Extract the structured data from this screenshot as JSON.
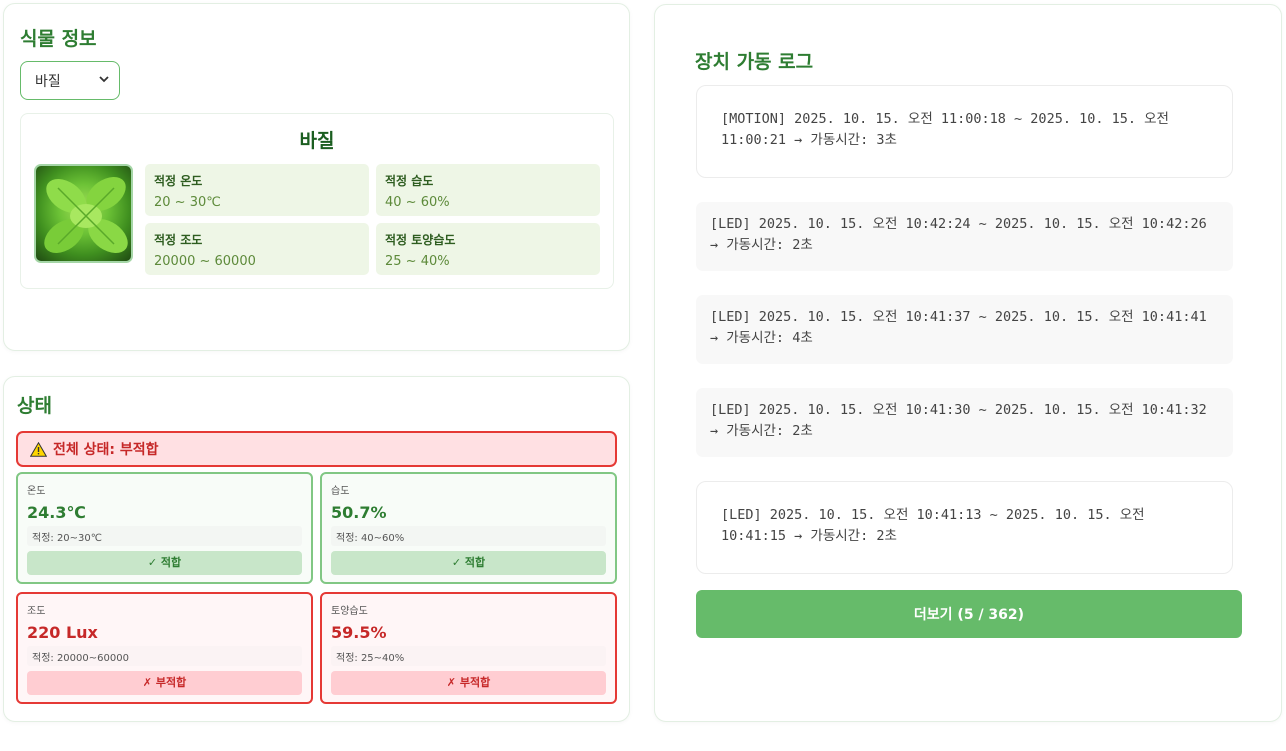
{
  "plant_info": {
    "title": "식물 정보",
    "selected_plant": "바질",
    "plant_name": "바질",
    "image_alt": "basil-plant",
    "ranges": [
      {
        "label": "적정 온도",
        "value": "20 ~ 30℃"
      },
      {
        "label": "적정 습도",
        "value": "40 ~ 60%"
      },
      {
        "label": "적정 조도",
        "value": "20000 ~ 60000"
      },
      {
        "label": "적정 토양습도",
        "value": "25 ~ 40%"
      }
    ]
  },
  "status": {
    "title": "상태",
    "overall": "전체 상태: 부적합",
    "overall_icon": "warning-icon",
    "sensors": [
      {
        "label": "온도",
        "value": "24.3℃",
        "range": "적정: 20~30℃",
        "badge": "✓ 적합",
        "ok": true
      },
      {
        "label": "습도",
        "value": "50.7%",
        "range": "적정: 40~60%",
        "badge": "✓ 적합",
        "ok": true
      },
      {
        "label": "조도",
        "value": "220 Lux",
        "range": "적정: 20000~60000",
        "badge": "✗ 부적합",
        "ok": false
      },
      {
        "label": "토양습도",
        "value": "59.5%",
        "range": "적정: 25~40%",
        "badge": "✗ 부적합",
        "ok": false
      }
    ],
    "colors": {
      "ok": "#2e7d32",
      "bad": "#c62828"
    }
  },
  "log": {
    "title": "장치 가동 로그",
    "items": [
      "[MOTION] 2025. 10. 15. 오전 11:00:18 ~ 2025. 10. 15. 오전 11:00:21 → 가동시간: 3초",
      "[LED] 2025. 10. 15. 오전 10:42:24 ~ 2025. 10. 15. 오전 10:42:26 → 가동시간: 2초",
      "[LED] 2025. 10. 15. 오전 10:41:37 ~ 2025. 10. 15. 오전 10:41:41 → 가동시간: 4초",
      "[LED] 2025. 10. 15. 오전 10:41:30 ~ 2025. 10. 15. 오전 10:41:32 → 가동시간: 2초",
      "[LED] 2025. 10. 15. 오전 10:41:13 ~ 2025. 10. 15. 오전 10:41:15 → 가동시간: 2초"
    ],
    "more_label": "더보기 (5 / 362)"
  },
  "colors": {
    "accent": "#66bb6a",
    "title": "#2e7d32"
  }
}
